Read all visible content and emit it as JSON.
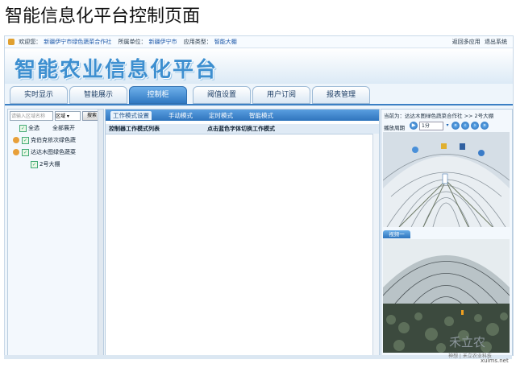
{
  "slide_title": "智能信息化平台控制页面",
  "topbar": {
    "welcome_label": "欢迎您：",
    "welcome_value": "新疆伊宁市绿色蔬菜合作社",
    "unit_label": "所属单位：",
    "unit_value": "新疆伊宁市",
    "app_type_label": "应用类型：",
    "app_type_value": "智能大棚",
    "back_link": "返回多应用",
    "logout_link": "退出系统"
  },
  "banner": {
    "title": "智能农业信息化平台"
  },
  "tabs": [
    {
      "label": "实时显示"
    },
    {
      "label": "智能展示"
    },
    {
      "label": "控制柜"
    },
    {
      "label": "阈值设置"
    },
    {
      "label": "用户订阅"
    },
    {
      "label": "报表管理"
    }
  ],
  "active_tab": "控制柜",
  "left": {
    "search_placeholder": "请输入区域名称",
    "select_value": "区域",
    "search_button": "搜索",
    "select_all": "全选",
    "expand_all": "全部展开",
    "tree": [
      {
        "label": "克伯克依次绿色蔬"
      },
      {
        "label": "达达木图绿色蔬菜"
      },
      {
        "label": "2号大棚"
      }
    ]
  },
  "center": {
    "mode_tabs": [
      "工作模式设置",
      "手动模式",
      "定时模式",
      "智能模式"
    ],
    "list_header_left": "控制器工作模式列表",
    "list_header_right": "点击蓝色字体切换工作模式"
  },
  "right": {
    "breadcrumb": "当前为：达达木图绿色蔬菜合作社 >> 2号大棚",
    "play_label": "播放周期",
    "speed_value": "1分",
    "video_label": "视频一"
  },
  "watermark": {
    "text": "禾立农",
    "sub": "神想 | 禾立农业科技",
    "site": "xuims.net"
  },
  "colors": {
    "accent": "#2f78c2",
    "tab_active": "#3b86d0",
    "banner_text": "#3d8fd0"
  }
}
